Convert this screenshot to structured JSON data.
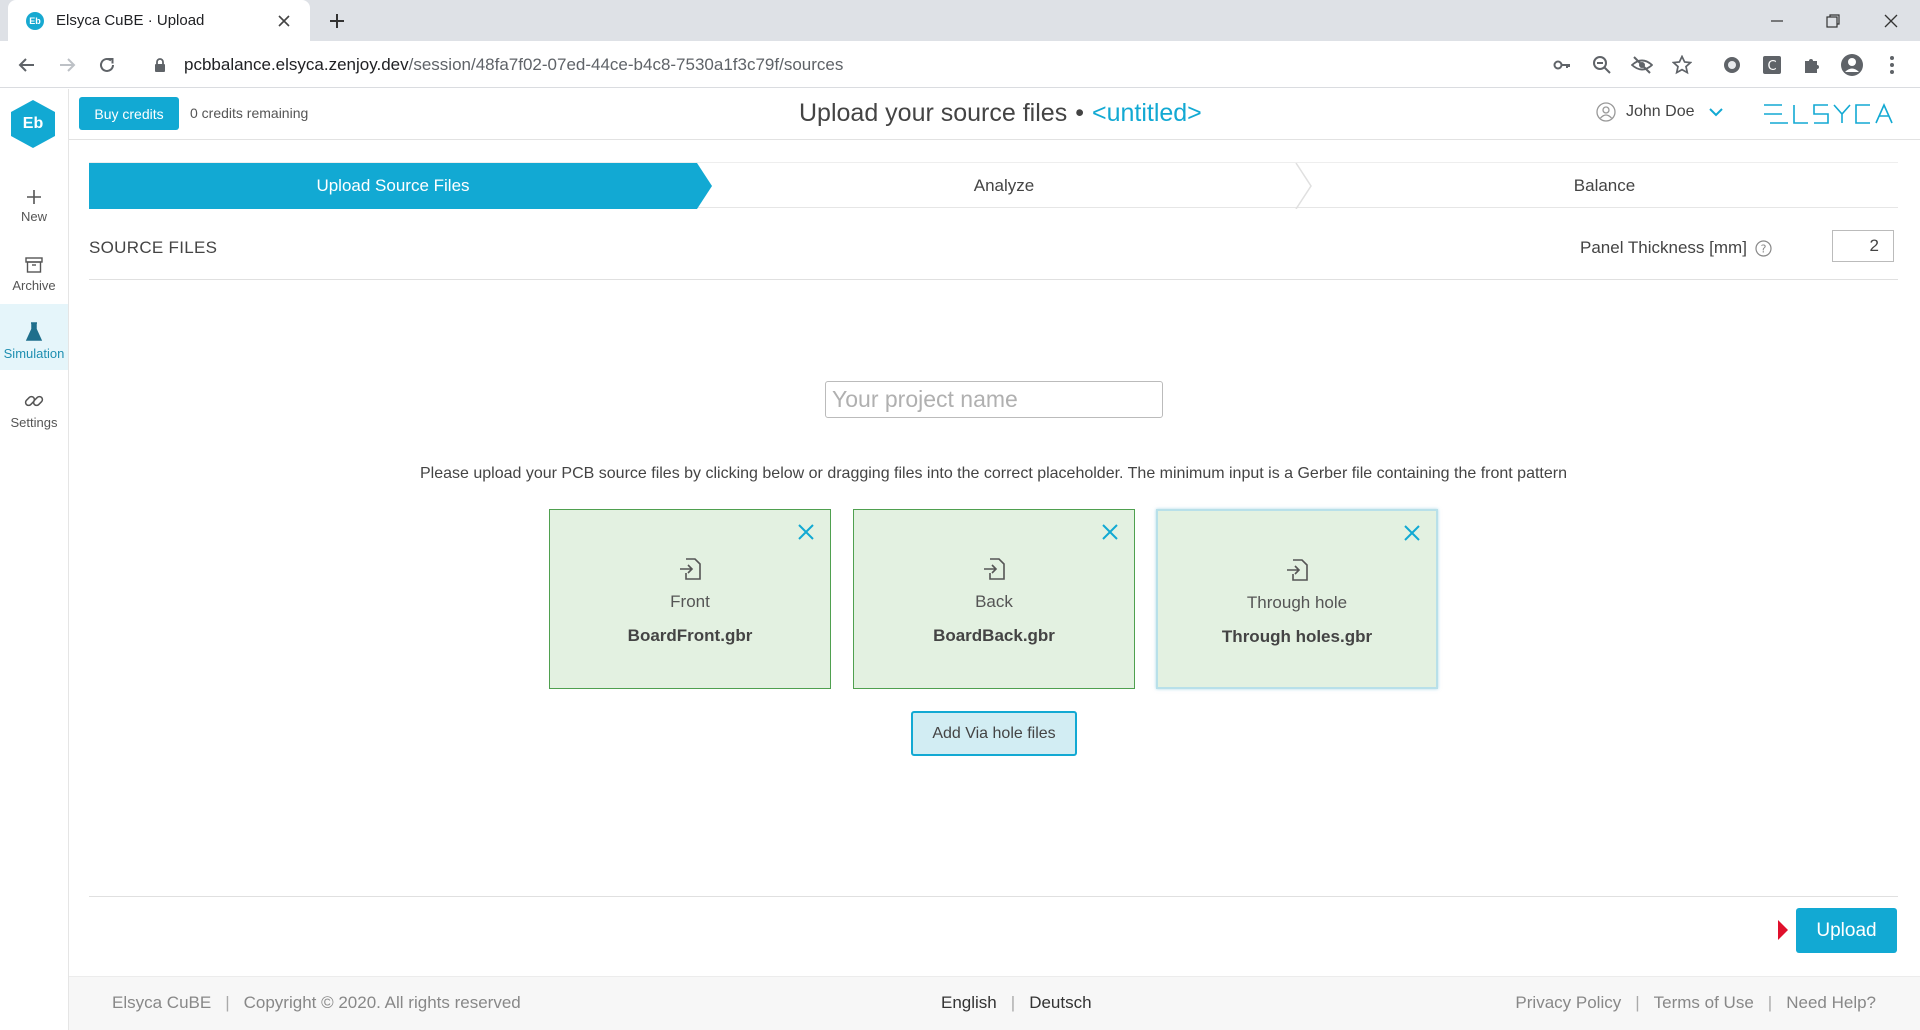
{
  "browser": {
    "tab_title": "Elsyca CuBE · Upload",
    "favicon_text": "Eb",
    "url_host": "pcbbalance.elsyca.zenjoy.dev",
    "url_path": "/session/48fa7f02-07ed-44ce-b4c8-7530a1f3c79f/sources"
  },
  "sidebar": {
    "logo_text": "Eb",
    "items": [
      {
        "label": "New",
        "icon": "plus-icon"
      },
      {
        "label": "Archive",
        "icon": "archive-icon"
      },
      {
        "label": "Simulation",
        "icon": "flask-icon",
        "active": true
      },
      {
        "label": "Settings",
        "icon": "link-icon"
      }
    ]
  },
  "header": {
    "buy_label": "Buy credits",
    "credits_text": "0 credits remaining",
    "title": "Upload your source files",
    "title_separator": "•",
    "project_status": "<untitled>",
    "user_name": "John Doe",
    "brand": "elsyca"
  },
  "steps": [
    {
      "label": "Upload Source Files",
      "active": true
    },
    {
      "label": "Analyze",
      "active": false
    },
    {
      "label": "Balance",
      "active": false
    }
  ],
  "source": {
    "section_title": "SOURCE FILES",
    "thickness_label": "Panel Thickness [mm]",
    "thickness_value": "2",
    "project_placeholder": "Your project name",
    "instructions": "Please upload your PCB source files by clicking below or dragging files into the correct placeholder. The minimum input is a Gerber file containing the front pattern",
    "files": [
      {
        "type": "Front",
        "name": "BoardFront.gbr"
      },
      {
        "type": "Back",
        "name": "BoardBack.gbr"
      },
      {
        "type": "Through hole",
        "name": "Through holes.gbr"
      }
    ],
    "via_button": "Add Via hole files",
    "upload_button": "Upload"
  },
  "footer": {
    "app_name": "Elsyca CuBE",
    "copyright": "Copyright © 2020. All rights reserved",
    "languages": [
      "English",
      "Deutsch"
    ],
    "links": [
      "Privacy Policy",
      "Terms of Use",
      "Need Help?"
    ],
    "separator": "|"
  },
  "colors": {
    "accent": "#12a9d3",
    "card_bg": "#e3f1e1",
    "card_border": "#4fa04f",
    "arrow_red": "#e0102c"
  }
}
